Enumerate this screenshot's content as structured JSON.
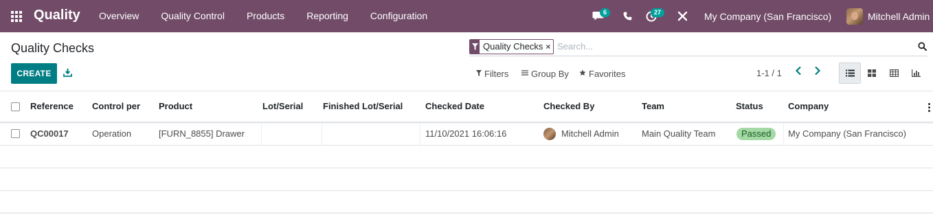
{
  "navbar": {
    "app_name": "Quality",
    "menu": [
      "Overview",
      "Quality Control",
      "Products",
      "Reporting",
      "Configuration"
    ],
    "messages_count": "6",
    "activities_count": "27",
    "company": "My Company (San Francisco)",
    "user_name": "Mitchell Admin",
    "brand_color": "#714b67"
  },
  "control_panel": {
    "title": "Quality Checks",
    "create_label": "CREATE",
    "search": {
      "facet": "Quality Checks",
      "placeholder": "Search..."
    },
    "filters_label": "Filters",
    "group_by_label": "Group By",
    "favorites_label": "Favorites",
    "pager": "1-1 / 1"
  },
  "table": {
    "columns": [
      "Reference",
      "Control per",
      "Product",
      "Lot/Serial",
      "Finished Lot/Serial",
      "Checked Date",
      "Checked By",
      "Team",
      "Status",
      "Company"
    ],
    "rows": [
      {
        "reference": "QC00017",
        "control_per": "Operation",
        "product": "[FURN_8855] Drawer",
        "lot_serial": "",
        "finished_lot_serial": "",
        "checked_date": "11/10/2021 16:06:16",
        "checked_by": "Mitchell Admin",
        "team": "Main Quality Team",
        "status": "Passed",
        "company": "My Company (San Francisco)"
      }
    ]
  },
  "icons": {
    "apps": "apps-grid-icon",
    "messages": "chat-icon",
    "phone": "phone-icon",
    "activities": "clock-icon",
    "debug": "tools-icon",
    "download": "download-icon",
    "search": "search-icon",
    "filter": "funnel-icon",
    "group_by": "list-icon",
    "favorites": "star-icon",
    "list_view": "list-view-icon",
    "kanban_view": "kanban-view-icon",
    "pivot_view": "pivot-view-icon",
    "graph_view": "graph-view-icon"
  }
}
